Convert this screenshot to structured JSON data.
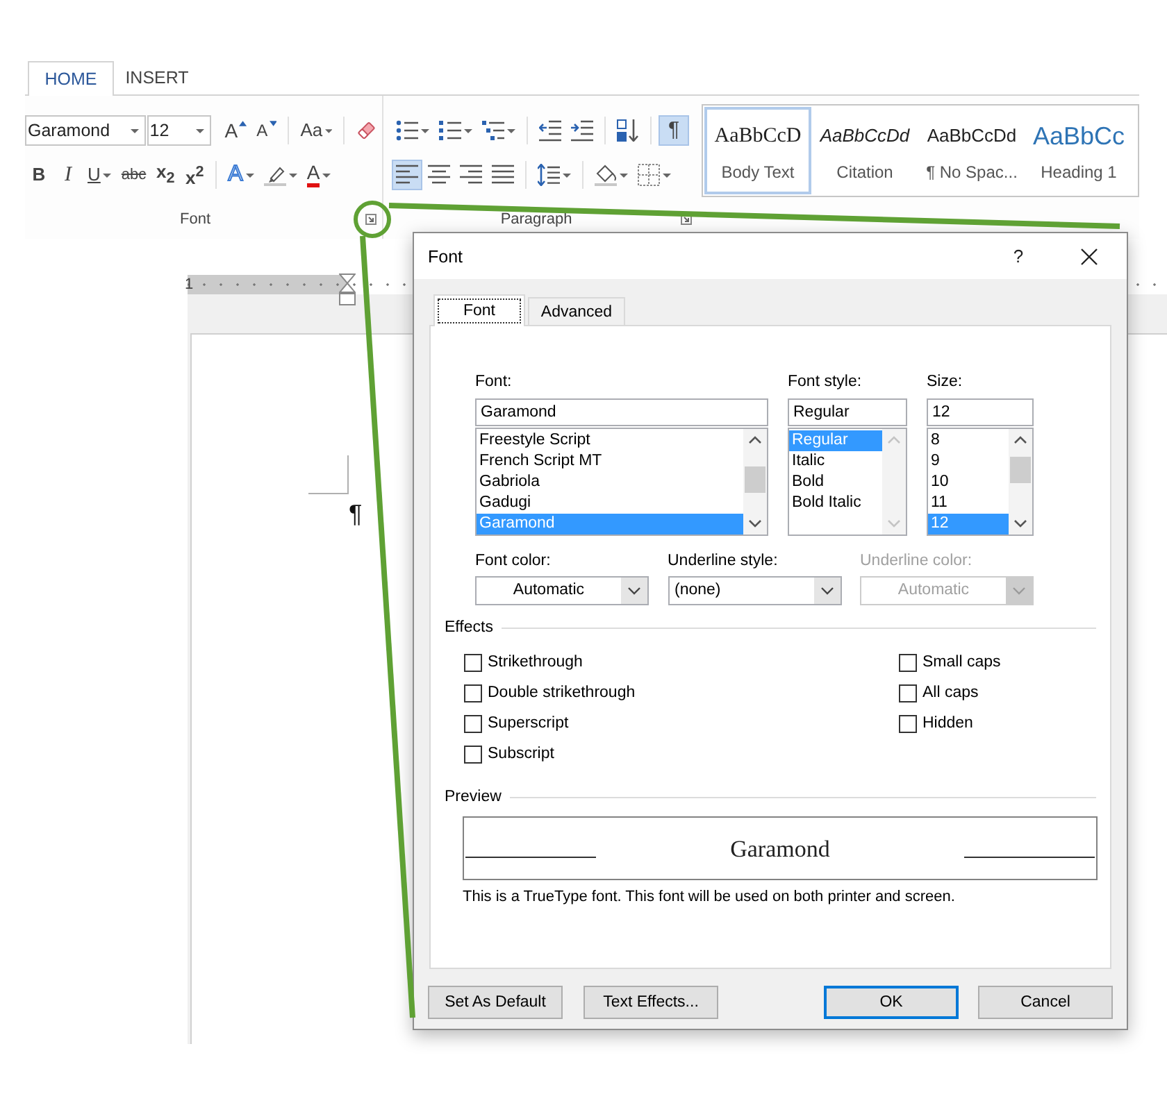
{
  "ribbon": {
    "tabs": [
      {
        "label": "HOME",
        "selected": true
      },
      {
        "label": "INSERT",
        "selected": false
      }
    ],
    "font_group": {
      "font_name": "Garamond",
      "font_size": "12",
      "row_1": [
        [
          {
            "kind": "grow",
            "label": "A",
            "dropdown": false
          },
          {
            "kind": "shrink",
            "label": "A",
            "dropdown": false
          }
        ],
        [
          {
            "kind": "case",
            "label": "Aa",
            "dropdown": true
          }
        ],
        [
          {
            "kind": "clear",
            "dropdown": false
          }
        ]
      ],
      "row_2": [
        [
          {
            "kind": "bold",
            "label": "B",
            "dropdown": false
          },
          {
            "kind": "italic",
            "label": "I",
            "dropdown": false
          },
          {
            "kind": "underline",
            "label": "U",
            "dropdown": true
          },
          {
            "kind": "strike",
            "label": "abc",
            "dropdown": false
          },
          {
            "kind": "subscript",
            "label": "x$_{2}$",
            "dropdown": false
          },
          {
            "kind": "superscript",
            "label": "x$^{2}$",
            "dropdown": false
          }
        ],
        [
          {
            "kind": "effects",
            "label": "A",
            "dropdown": true
          },
          {
            "kind": "highlight",
            "dropdown": true
          },
          {
            "kind": "font_color",
            "label": "A",
            "dropdown": true
          }
        ]
      ],
      "label": "Font"
    },
    "paragraph_group": {
      "row_1": [
        [
          {
            "kind": "bullets",
            "dropdown": true,
            "on": false
          },
          {
            "kind": "numbering",
            "dropdown": true,
            "on": false
          },
          {
            "kind": "multilevel",
            "dropdown": true,
            "on": false
          }
        ],
        [
          {
            "kind": "outdent",
            "dropdown": false,
            "on": false
          },
          {
            "kind": "indent",
            "dropdown": false,
            "on": false
          }
        ],
        [
          {
            "kind": "sort",
            "dropdown": false,
            "on": false
          }
        ],
        [
          {
            "kind": "marks",
            "label": "¶",
            "dropdown": false,
            "on": true
          }
        ]
      ],
      "row_2": [
        [
          {
            "kind": "align_left",
            "dropdown": false,
            "on": true
          },
          {
            "kind": "align_center",
            "dropdown": false,
            "on": false
          },
          {
            "kind": "align_right",
            "dropdown": false,
            "on": false
          },
          {
            "kind": "justify",
            "dropdown": false,
            "on": false
          }
        ],
        [
          {
            "kind": "spacing",
            "dropdown": true,
            "on": false
          }
        ],
        [
          {
            "kind": "shading",
            "dropdown": true,
            "on": false
          },
          {
            "kind": "borders",
            "dropdown": true,
            "on": false
          }
        ]
      ],
      "label": "Paragraph"
    },
    "styles": [
      {
        "sample": "AaBbCcD",
        "name": "Body Text",
        "kind": "serif",
        "selected": true
      },
      {
        "sample": "AaBbCcDd",
        "name": "Citation",
        "kind": "italic",
        "selected": false
      },
      {
        "sample": "AaBbCcDd",
        "name": "¶ No Spac...",
        "kind": "plain",
        "selected": false
      },
      {
        "sample": "AaBbCc",
        "name": "Heading 1",
        "kind": "heading",
        "selected": false
      }
    ]
  },
  "document": {
    "ruler_number": "1",
    "paragraph_mark": "¶"
  },
  "font_dialog": {
    "title": "Font",
    "help": "?",
    "tabs": [
      {
        "label": "Font",
        "selected": true
      },
      {
        "label": "Advanced",
        "selected": false
      }
    ],
    "lists": [
      {
        "kind": "font",
        "label": "Font:",
        "value": "Garamond",
        "scrollable": true,
        "options": [
          {
            "label": "Freestyle Script",
            "selected": false
          },
          {
            "label": "French Script MT",
            "selected": false
          },
          {
            "label": "Gabriola",
            "selected": false
          },
          {
            "label": "Gadugi",
            "selected": false
          },
          {
            "label": "Garamond",
            "selected": true
          }
        ]
      },
      {
        "kind": "style",
        "label": "Font style:",
        "value": "Regular",
        "scrollable": false,
        "options": [
          {
            "label": "Regular",
            "selected": true
          },
          {
            "label": "Italic",
            "selected": false
          },
          {
            "label": "Bold",
            "selected": false
          },
          {
            "label": "Bold Italic",
            "selected": false
          }
        ]
      },
      {
        "kind": "size",
        "label": "Size:",
        "value": "12",
        "scrollable": true,
        "options": [
          {
            "label": "8",
            "selected": false
          },
          {
            "label": "9",
            "selected": false
          },
          {
            "label": "10",
            "selected": false
          },
          {
            "label": "11",
            "selected": false
          },
          {
            "label": "12",
            "selected": true
          }
        ]
      }
    ],
    "dropdowns": [
      {
        "kind": "font_color",
        "label": "Font color:",
        "value": "Automatic",
        "disabled": false
      },
      {
        "kind": "underline_style",
        "label": "Underline style:",
        "value": "(none)",
        "disabled": false
      },
      {
        "kind": "underline_color",
        "label": "Underline color:",
        "value": "Automatic",
        "disabled": true
      }
    ],
    "effects": {
      "title": "Effects",
      "columns": [
        [
          {
            "label": "Strikethrough",
            "checked": false
          },
          {
            "label": "Double strikethrough",
            "checked": false
          },
          {
            "label": "Superscript",
            "checked": false
          },
          {
            "label": "Subscript",
            "checked": false
          }
        ],
        [
          {
            "label": "Small caps",
            "checked": false
          },
          {
            "label": "All caps",
            "checked": false
          },
          {
            "label": "Hidden",
            "checked": false
          }
        ]
      ]
    },
    "preview": {
      "title": "Preview",
      "sample": "Garamond",
      "note": "This is a TrueType font. This font will be used on both printer and screen."
    },
    "buttons_left": [
      {
        "label": "Set As Default",
        "default": false
      },
      {
        "label": "Text Effects...",
        "default": false
      }
    ],
    "buttons_right": [
      {
        "label": "OK",
        "default": true
      },
      {
        "label": "Cancel",
        "default": false
      }
    ]
  }
}
